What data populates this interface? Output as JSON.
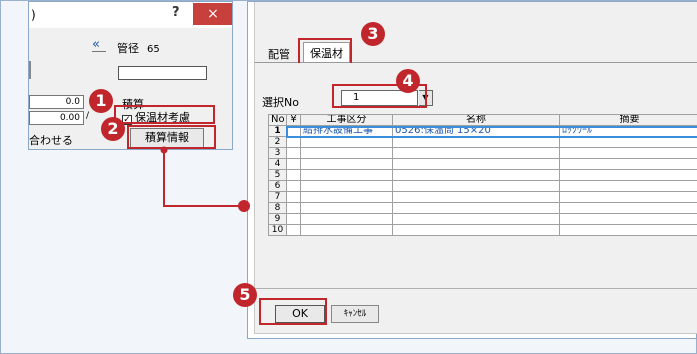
{
  "left_dialog": {
    "title_fragment": ")",
    "help_label": "?",
    "close_label": "×",
    "collapse_label": "«",
    "pipe_label": "管径",
    "pipe_value": "65",
    "value1": "0.0",
    "value2": "0.00",
    "value2_tail": "/",
    "sekisan_label": "積算",
    "insulation_checkbox_label": "保温材考慮",
    "checkbox_mark": "✓",
    "sekisan_button": "積算情報",
    "align_label": "合わせる"
  },
  "right_dialog": {
    "tab_pipe": "配管",
    "tab_insulation": "保温材",
    "select_label": "選択No",
    "select_value": "1",
    "select_arrow": "▼",
    "columns": [
      "No",
      "¥",
      "工事区分",
      "名称",
      "摘要"
    ],
    "rows": [
      {
        "no": "1",
        "yen": "",
        "category": "給排水設備工事",
        "name": "0526:保温筒 15×20",
        "note": "ﾛｯｸｳｰﾙ"
      },
      {
        "no": "2",
        "yen": "",
        "category": "",
        "name": "",
        "note": ""
      },
      {
        "no": "3",
        "yen": "",
        "category": "",
        "name": "",
        "note": ""
      },
      {
        "no": "4",
        "yen": "",
        "category": "",
        "name": "",
        "note": ""
      },
      {
        "no": "5",
        "yen": "",
        "category": "",
        "name": "",
        "note": ""
      },
      {
        "no": "6",
        "yen": "",
        "category": "",
        "name": "",
        "note": ""
      },
      {
        "no": "7",
        "yen": "",
        "category": "",
        "name": "",
        "note": ""
      },
      {
        "no": "8",
        "yen": "",
        "category": "",
        "name": "",
        "note": ""
      },
      {
        "no": "9",
        "yen": "",
        "category": "",
        "name": "",
        "note": ""
      },
      {
        "no": "10",
        "yen": "",
        "category": "",
        "name": "",
        "note": ""
      }
    ],
    "ok_button": "OK",
    "cancel_button": "ｷｬﾝｾﾙ"
  },
  "badges": [
    "1",
    "2",
    "3",
    "4",
    "5"
  ],
  "colors": {
    "highlight": "#c0262c",
    "selection": "#3a8ee0",
    "close": "#c8403c"
  }
}
